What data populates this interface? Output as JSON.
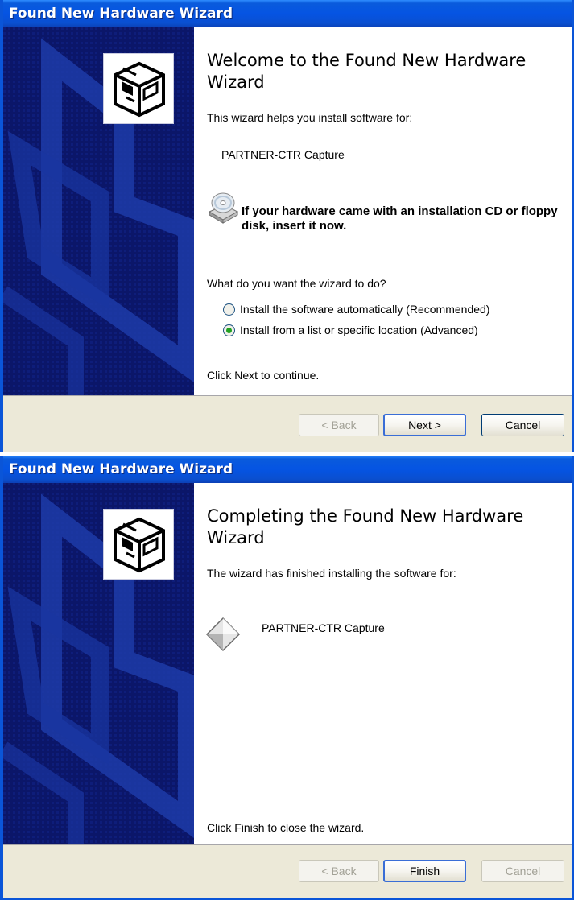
{
  "window1": {
    "title": "Found New Hardware Wizard",
    "heading": "Welcome to the Found New Hardware Wizard",
    "intro": "This wizard helps you install software for:",
    "device_name": "PARTNER-CTR Capture",
    "cd_prompt": "If your hardware came with an installation CD or floppy disk, insert it now.",
    "question": "What do you want the wizard to do?",
    "options": [
      {
        "label": "Install the software automatically (Recommended)",
        "selected": false
      },
      {
        "label": "Install from a list or specific location (Advanced)",
        "selected": true
      }
    ],
    "continue_text": "Click Next to continue.",
    "back_label": "< Back",
    "next_label": "Next >",
    "cancel_label": "Cancel"
  },
  "window2": {
    "title": "Found New Hardware Wizard",
    "heading": "Completing the Found New Hardware Wizard",
    "intro": "The wizard has finished installing the software for:",
    "device_name": "PARTNER-CTR Capture",
    "close_text": "Click Finish to close the wizard.",
    "back_label": "< Back",
    "finish_label": "Finish",
    "cancel_label": "Cancel"
  },
  "colors": {
    "titlebar": "#0554e3",
    "banner": "#0b1669",
    "selected_radio": "#21a121"
  },
  "icons": [
    "hardware-wizard-icon",
    "cd-icon",
    "device-icon"
  ]
}
